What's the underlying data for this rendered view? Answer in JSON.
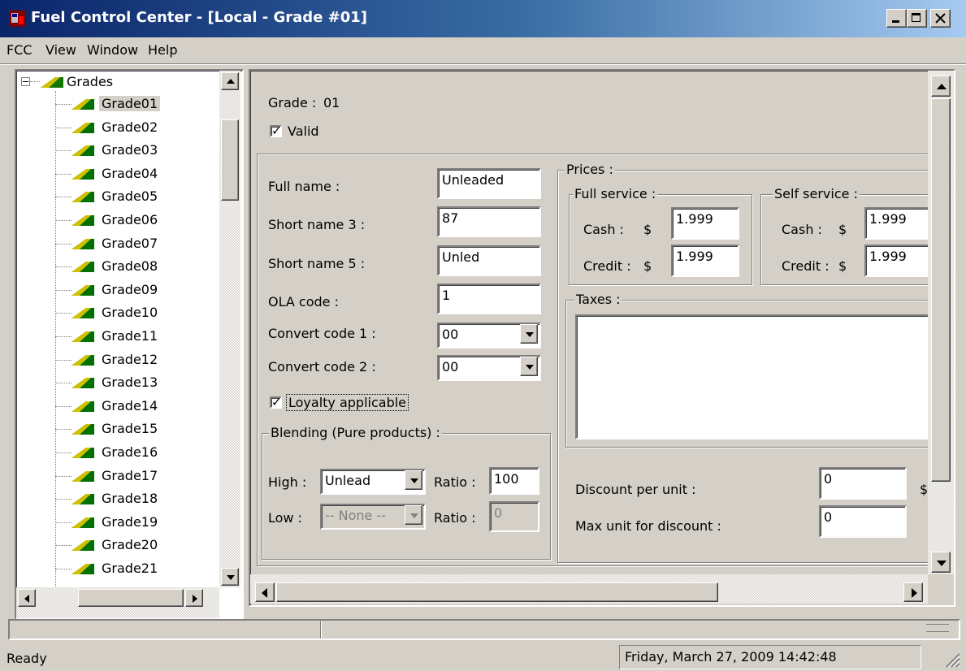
{
  "window": {
    "title": "Fuel Control Center - [Local - Grade #01]",
    "icons": [
      "app-icon",
      "minimize-icon",
      "restore-icon",
      "close-icon"
    ]
  },
  "menu": {
    "items": [
      "FCC",
      "View",
      "Window",
      "Help"
    ]
  },
  "tree": {
    "root": "Grades",
    "items": [
      "Grade01",
      "Grade02",
      "Grade03",
      "Grade04",
      "Grade05",
      "Grade06",
      "Grade07",
      "Grade08",
      "Grade09",
      "Grade10",
      "Grade11",
      "Grade12",
      "Grade13",
      "Grade14",
      "Grade15",
      "Grade16",
      "Grade17",
      "Grade18",
      "Grade19",
      "Grade20",
      "Grade21"
    ],
    "selected": "Grade01"
  },
  "grade": {
    "label": "Grade :",
    "value": "01",
    "valid_label": "Valid",
    "valid_checked": true
  },
  "fields": {
    "full_name_label": "Full name :",
    "full_name": "Unleaded",
    "short3_label": "Short name 3 :",
    "short3": "87",
    "short5_label": "Short name 5 :",
    "short5": "Unled",
    "ola_label": "OLA code :",
    "ola": "1",
    "convert1_label": "Convert code 1 :",
    "convert1": "00",
    "convert2_label": "Convert code 2 :",
    "convert2": "00",
    "loyalty_label": "Loyalty applicable",
    "loyalty_checked": true
  },
  "blending": {
    "title": "Blending (Pure products) :",
    "high_label": "High :",
    "high_value": "Unlead",
    "high_ratio_label": "Ratio :",
    "high_ratio": "100",
    "low_label": "Low :",
    "low_value": "-- None --",
    "low_ratio_label": "Ratio :",
    "low_ratio": "0"
  },
  "prices": {
    "title": "Prices :",
    "full_title": "Full service :",
    "self_title": "Self service :",
    "cash_label": "Cash :",
    "credit_label": "Credit :",
    "currency": "$",
    "full_cash": "1.999",
    "full_credit": "1.999",
    "self_cash": "1.999",
    "self_credit": "1.999"
  },
  "taxes": {
    "title": "Taxes :"
  },
  "discount": {
    "per_unit_label": "Discount per unit :",
    "per_unit": "0",
    "per_unit_suffix": "$",
    "max_label": "Max unit for discount :",
    "max": "0"
  },
  "status": {
    "ready": "Ready",
    "datetime": "Friday, March 27, 2009 14:42:48"
  },
  "colors": {
    "title_start": "#0a246a",
    "title_end": "#a6caf0",
    "face": "#d4d0c8"
  }
}
